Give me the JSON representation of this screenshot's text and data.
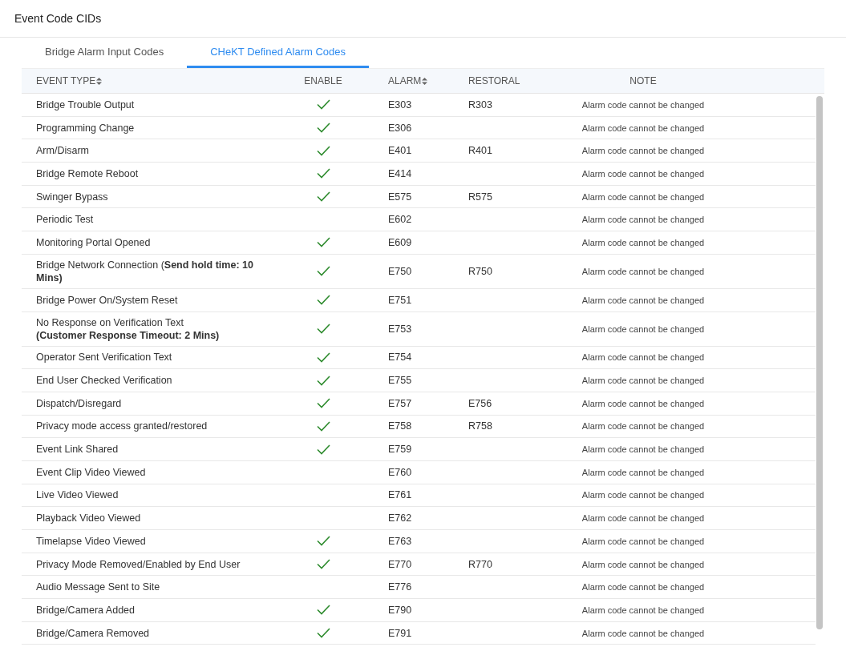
{
  "page_title": "Event Code CIDs",
  "tabs": [
    {
      "label": "Bridge Alarm Input Codes",
      "selected": false
    },
    {
      "label": "CHeKT Defined Alarm Codes",
      "selected": true
    }
  ],
  "columns": [
    {
      "label": "EVENT TYPE",
      "sortable": true
    },
    {
      "label": "ENABLE",
      "sortable": false
    },
    {
      "label": "ALARM",
      "sortable": true
    },
    {
      "label": "RESTORAL",
      "sortable": false
    },
    {
      "label": "NOTE",
      "sortable": false
    }
  ],
  "rows": [
    {
      "event_type": "Bridge Trouble Output",
      "enabled": true,
      "alarm": "E303",
      "restoral": "R303",
      "note": "Alarm code cannot be changed"
    },
    {
      "event_type": "Programming Change",
      "enabled": true,
      "alarm": "E306",
      "restoral": "",
      "note": "Alarm code cannot be changed"
    },
    {
      "event_type": "Arm/Disarm",
      "enabled": true,
      "alarm": "E401",
      "restoral": "R401",
      "note": "Alarm code cannot be changed"
    },
    {
      "event_type": "Bridge Remote Reboot",
      "enabled": true,
      "alarm": "E414",
      "restoral": "",
      "note": "Alarm code cannot be changed"
    },
    {
      "event_type": "Swinger Bypass",
      "enabled": true,
      "alarm": "E575",
      "restoral": "R575",
      "note": "Alarm code cannot be changed"
    },
    {
      "event_type": "Periodic Test",
      "enabled": false,
      "alarm": "E602",
      "restoral": "",
      "note": "Alarm code cannot be changed"
    },
    {
      "event_type": "Monitoring Portal Opened",
      "enabled": true,
      "alarm": "E609",
      "restoral": "",
      "note": "Alarm code cannot be changed"
    },
    {
      "event_type": "Bridge Network Connection (**Send hold time: 10 Mins)**",
      "enabled": true,
      "alarm": "E750",
      "restoral": "R750",
      "note": "Alarm code cannot be changed"
    },
    {
      "event_type": "Bridge Power On/System Reset",
      "enabled": true,
      "alarm": "E751",
      "restoral": "",
      "note": "Alarm code cannot be changed"
    },
    {
      "event_type": "No Response on Verification Text\n**(Customer Response Timeout: 2 Mins)**",
      "enabled": true,
      "alarm": "E753",
      "restoral": "",
      "note": "Alarm code cannot be changed"
    },
    {
      "event_type": "Operator Sent Verification Text",
      "enabled": true,
      "alarm": "E754",
      "restoral": "",
      "note": "Alarm code cannot be changed"
    },
    {
      "event_type": "End User Checked Verification",
      "enabled": true,
      "alarm": "E755",
      "restoral": "",
      "note": "Alarm code cannot be changed"
    },
    {
      "event_type": "Dispatch/Disregard",
      "enabled": true,
      "alarm": "E757",
      "restoral": "E756",
      "note": "Alarm code cannot be changed"
    },
    {
      "event_type": "Privacy mode access granted/restored",
      "enabled": true,
      "alarm": "E758",
      "restoral": "R758",
      "note": "Alarm code cannot be changed"
    },
    {
      "event_type": "Event Link Shared",
      "enabled": true,
      "alarm": "E759",
      "restoral": "",
      "note": "Alarm code cannot be changed"
    },
    {
      "event_type": "Event Clip Video Viewed",
      "enabled": false,
      "alarm": "E760",
      "restoral": "",
      "note": "Alarm code cannot be changed"
    },
    {
      "event_type": "Live Video Viewed",
      "enabled": false,
      "alarm": "E761",
      "restoral": "",
      "note": "Alarm code cannot be changed"
    },
    {
      "event_type": "Playback Video Viewed",
      "enabled": false,
      "alarm": "E762",
      "restoral": "",
      "note": "Alarm code cannot be changed"
    },
    {
      "event_type": "Timelapse Video Viewed",
      "enabled": true,
      "alarm": "E763",
      "restoral": "",
      "note": "Alarm code cannot be changed"
    },
    {
      "event_type": "Privacy Mode Removed/Enabled by End User",
      "enabled": true,
      "alarm": "E770",
      "restoral": "R770",
      "note": "Alarm code cannot be changed"
    },
    {
      "event_type": "Audio Message Sent to Site",
      "enabled": false,
      "alarm": "E776",
      "restoral": "",
      "note": "Alarm code cannot be changed"
    },
    {
      "event_type": "Bridge/Camera Added",
      "enabled": true,
      "alarm": "E790",
      "restoral": "",
      "note": "Alarm code cannot be changed"
    },
    {
      "event_type": "Bridge/Camera Removed",
      "enabled": true,
      "alarm": "E791",
      "restoral": "",
      "note": "Alarm code cannot be changed"
    }
  ]
}
